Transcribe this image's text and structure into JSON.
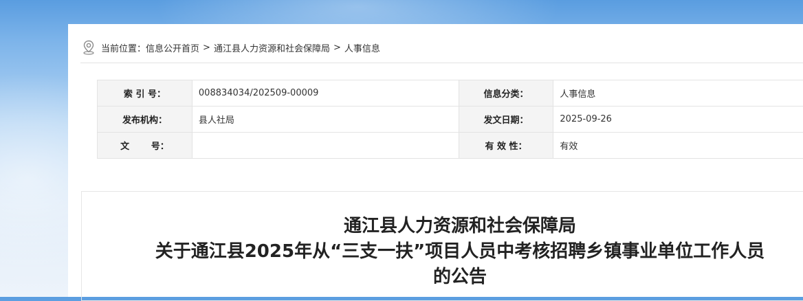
{
  "breadcrumb": {
    "prefix": "当前位置：",
    "items": [
      "信息公开首页",
      "通江县人力资源和社会保障局",
      "人事信息"
    ],
    "separator": ">"
  },
  "meta": {
    "index_label": "索 引 号：",
    "index_value": "008834034/202509-00009",
    "category_label": "信息分类：",
    "category_value": "人事信息",
    "publisher_label": "发布机构：",
    "publisher_value": "县人社局",
    "date_label": "发文日期：",
    "date_value": "2025-09-26",
    "docno_label": "文       号：",
    "docno_value": "",
    "validity_label": "有 效 性：",
    "validity_value": "有效"
  },
  "article": {
    "title_line1": "通江县人力资源和社会保障局",
    "title_line2": "关于通江县2025年从“三支一扶”项目人员中考核招聘乡镇事业单位工作人员",
    "title_line3": "的公告"
  }
}
